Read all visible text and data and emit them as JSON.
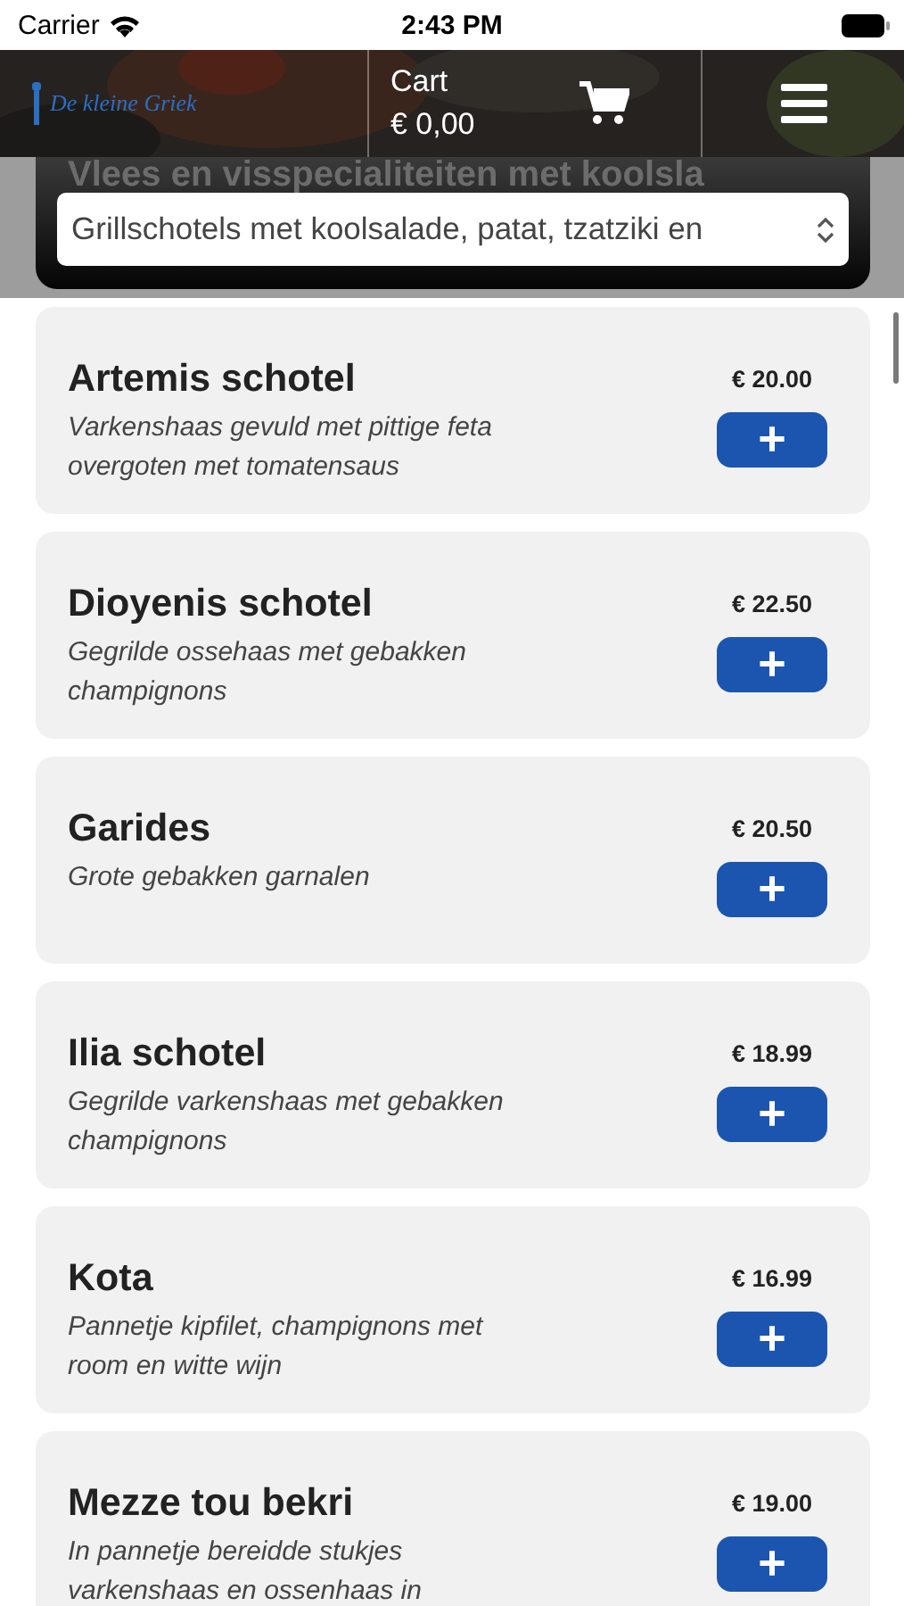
{
  "status_bar": {
    "carrier": "Carrier",
    "time": "2:43 PM"
  },
  "header": {
    "logo": "De kleine Griek",
    "cart_label": "Cart",
    "cart_total": "€ 0,00"
  },
  "category": {
    "heading": "Vlees en visspecialiteiten met koolsla",
    "select_value": "Grillschotels met koolsalade, patat, tzatziki en"
  },
  "items": [
    {
      "name": "Artemis schotel",
      "description": "Varkenshaas gevuld met pittige feta overgoten met tomatensaus",
      "price": "€ 20.00",
      "button": "+"
    },
    {
      "name": "Dioyenis schotel",
      "description": "Gegrilde ossehaas met gebakken champignons",
      "price": "€ 22.50",
      "button": "+"
    },
    {
      "name": "Garides",
      "description": "Grote gebakken garnalen",
      "price": "€ 20.50",
      "button": "+"
    },
    {
      "name": "Ilia schotel",
      "description": "Gegrilde varkenshaas met gebakken champignons",
      "price": "€ 18.99",
      "button": "+"
    },
    {
      "name": "Kota",
      "description": "Pannetje kipfilet, champignons met room en witte wijn",
      "price": "€ 16.99",
      "button": "+"
    },
    {
      "name": "Mezze tou bekri",
      "description": "In pannetje bereidde stukjes varkenshaas en ossenhaas in",
      "price": "€ 19.00",
      "button": "+"
    }
  ]
}
